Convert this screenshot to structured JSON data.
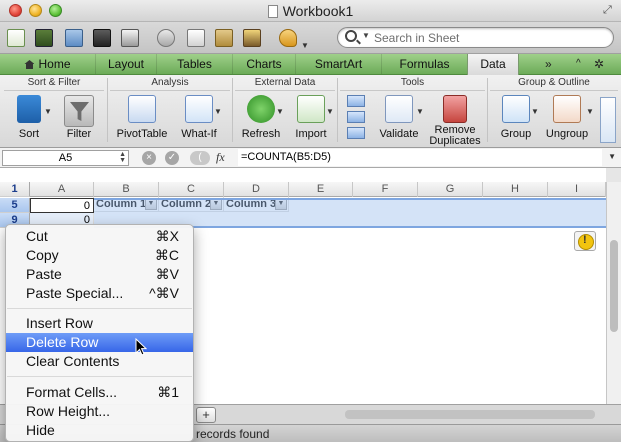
{
  "window": {
    "title": "Workbook1"
  },
  "search": {
    "placeholder": "Search in Sheet"
  },
  "tabs": [
    {
      "label": "Home"
    },
    {
      "label": "Layout"
    },
    {
      "label": "Tables"
    },
    {
      "label": "Charts"
    },
    {
      "label": "SmartArt"
    },
    {
      "label": "Formulas"
    },
    {
      "label": "Data"
    }
  ],
  "ribbon": {
    "groups": {
      "sort_filter": "Sort & Filter",
      "analysis": "Analysis",
      "external": "External Data",
      "tools": "Tools",
      "group_outline": "Group & Outline"
    },
    "buttons": {
      "sort": "Sort",
      "filter": "Filter",
      "pivot": "PivotTable",
      "whatif": "What-If",
      "refresh": "Refresh",
      "import": "Import",
      "validate": "Validate",
      "remove_dup_1": "Remove",
      "remove_dup_2": "Duplicates",
      "group": "Group",
      "ungroup": "Ungroup"
    }
  },
  "formula_bar": {
    "name_box": "A5",
    "fx": "fx",
    "formula": "=COUNTA(B5:D5)"
  },
  "grid": {
    "columns": [
      "A",
      "B",
      "C",
      "D",
      "E",
      "F",
      "G",
      "H",
      "I"
    ],
    "rows": [
      {
        "header": "1",
        "cells": [
          "",
          "Column 1",
          "Column 2",
          "Column 3"
        ]
      },
      {
        "header": "5",
        "cells": [
          "0"
        ]
      },
      {
        "header": "9",
        "cells": [
          "0"
        ]
      }
    ]
  },
  "context_menu": {
    "items": [
      {
        "label": "Cut",
        "shortcut": "⌘X"
      },
      {
        "label": "Copy",
        "shortcut": "⌘C"
      },
      {
        "label": "Paste",
        "shortcut": "⌘V"
      },
      {
        "label": "Paste Special...",
        "shortcut": "^⌘V"
      },
      {
        "label": "Insert Row",
        "shortcut": ""
      },
      {
        "label": "Delete Row",
        "shortcut": ""
      },
      {
        "label": "Clear Contents",
        "shortcut": ""
      },
      {
        "label": "Format Cells...",
        "shortcut": "⌘1"
      },
      {
        "label": "Row Height...",
        "shortcut": ""
      },
      {
        "label": "Hide",
        "shortcut": ""
      }
    ]
  },
  "sheet_bar": {
    "add_label": "+"
  },
  "status": {
    "text": "records found"
  },
  "colors": {
    "accent_tab": "#6cab58",
    "highlight": "#3766e8",
    "selection": "#a0c0ee"
  }
}
